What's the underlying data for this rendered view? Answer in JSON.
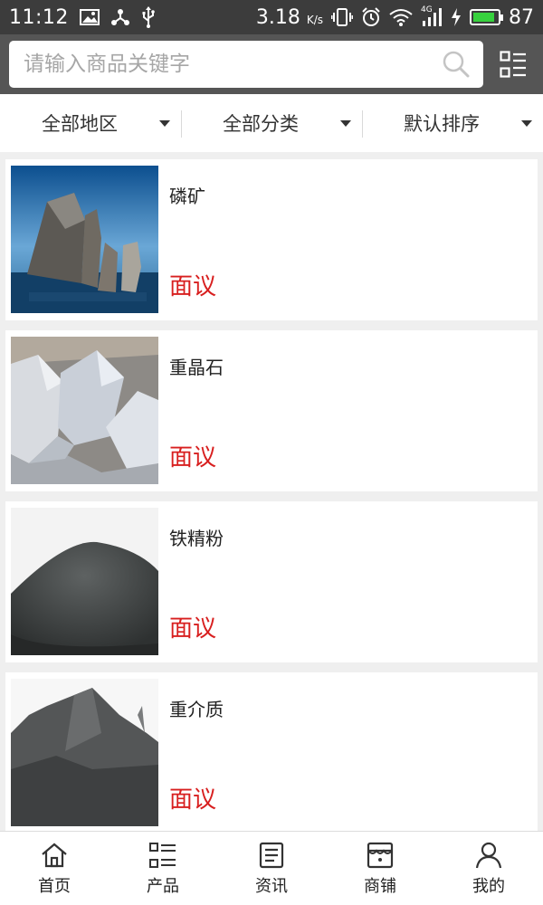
{
  "status_bar": {
    "time": "11:12",
    "net_speed": "3.18",
    "net_unit": "K/s",
    "network_type": "4G",
    "battery": "87",
    "battery_color": "#37d13d"
  },
  "search": {
    "placeholder": "请输入商品关键字"
  },
  "filters": [
    {
      "label": "全部地区"
    },
    {
      "label": "全部分类"
    },
    {
      "label": "默认排序"
    }
  ],
  "products": [
    {
      "name": "磷矿",
      "price": "面议",
      "image": "phosphate-rock-photo"
    },
    {
      "name": "重晶石",
      "price": "面议",
      "image": "barite-photo"
    },
    {
      "name": "铁精粉",
      "price": "面议",
      "image": "iron-concentrate-powder-photo"
    },
    {
      "name": "重介质",
      "price": "面议",
      "image": "dense-medium-pile-photo"
    }
  ],
  "nav": [
    {
      "label": "首页",
      "icon": "home-icon"
    },
    {
      "label": "产品",
      "icon": "product-list-icon"
    },
    {
      "label": "资讯",
      "icon": "news-icon"
    },
    {
      "label": "商铺",
      "icon": "shop-icon"
    },
    {
      "label": "我的",
      "icon": "user-icon"
    }
  ],
  "colors": {
    "header_bg": "#555555",
    "status_bg": "#3c3c3c",
    "price_red": "#d81f1f"
  }
}
